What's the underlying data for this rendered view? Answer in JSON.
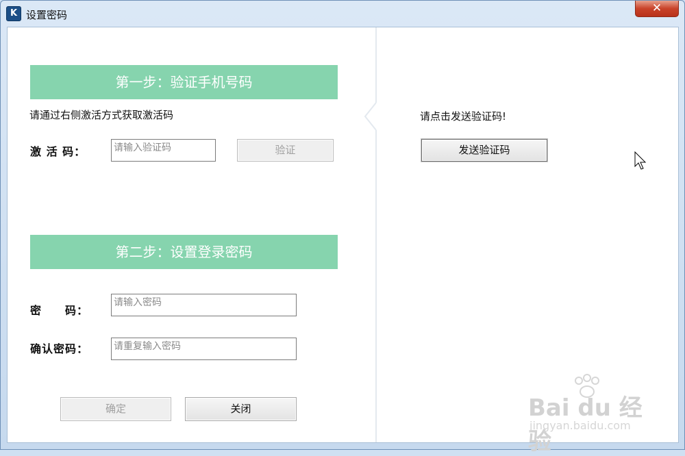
{
  "window": {
    "title": "设置密码",
    "icon": "kb-app-icon",
    "close_symbol": "✕"
  },
  "left": {
    "step1": {
      "title": "第一步：验证手机号码",
      "hint": "请通过右侧激活方式获取激活码",
      "code_label": "激 活 码：",
      "code_placeholder": "请输入验证码",
      "verify_label": "验证"
    },
    "step2": {
      "title": "第二步：设置登录密码",
      "password_label": "密　　码：",
      "password_placeholder": "请输入密码",
      "confirm_label": "确认密码：",
      "confirm_placeholder": "请重复输入密码"
    },
    "buttons": {
      "ok_label": "确定",
      "close_label": "关闭"
    }
  },
  "right": {
    "hint": "请点击发送验证码!",
    "send_label": "发送验证码"
  },
  "watermark": {
    "logo": "Bai du 经验",
    "sub": "jingyan.baidu.com"
  },
  "colors": {
    "step_header": "#86d4ae",
    "close_button": "#c9432a"
  }
}
